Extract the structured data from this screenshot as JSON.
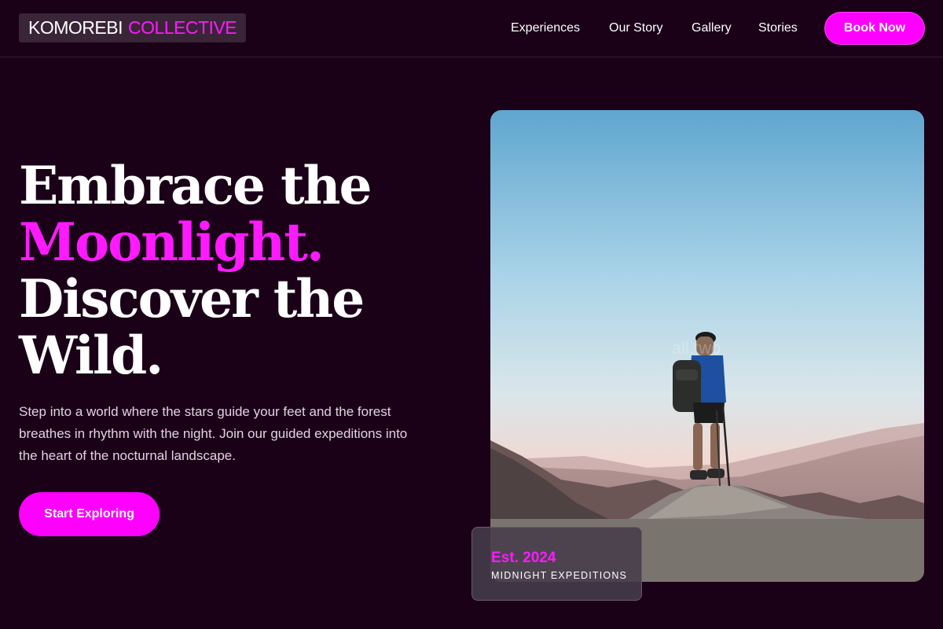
{
  "brand": {
    "name_part1": "KOMOREBI",
    "name_part2": "COLLECTIVE"
  },
  "nav": {
    "items": [
      "Experiences",
      "Our Story",
      "Gallery",
      "Stories"
    ],
    "cta_label": "Book Now"
  },
  "hero": {
    "headline_line1": "Embrace the",
    "headline_line2": "Moonlight.",
    "headline_line3": "Discover the",
    "headline_line4": "Wild.",
    "subtext": "Step into a world where the stars guide your feet and the forest breathes in rhythm with the night. Join our guided expeditions into the heart of the nocturnal landscape.",
    "cta_label": "Start Exploring"
  },
  "badge": {
    "est": "Est. 2024",
    "subtitle": "MIDNIGHT EXPEDITIONS"
  },
  "watermark": "all.two",
  "colors": {
    "background": "#1a0118",
    "accent": "#ff00ff",
    "text": "#ffffff"
  }
}
